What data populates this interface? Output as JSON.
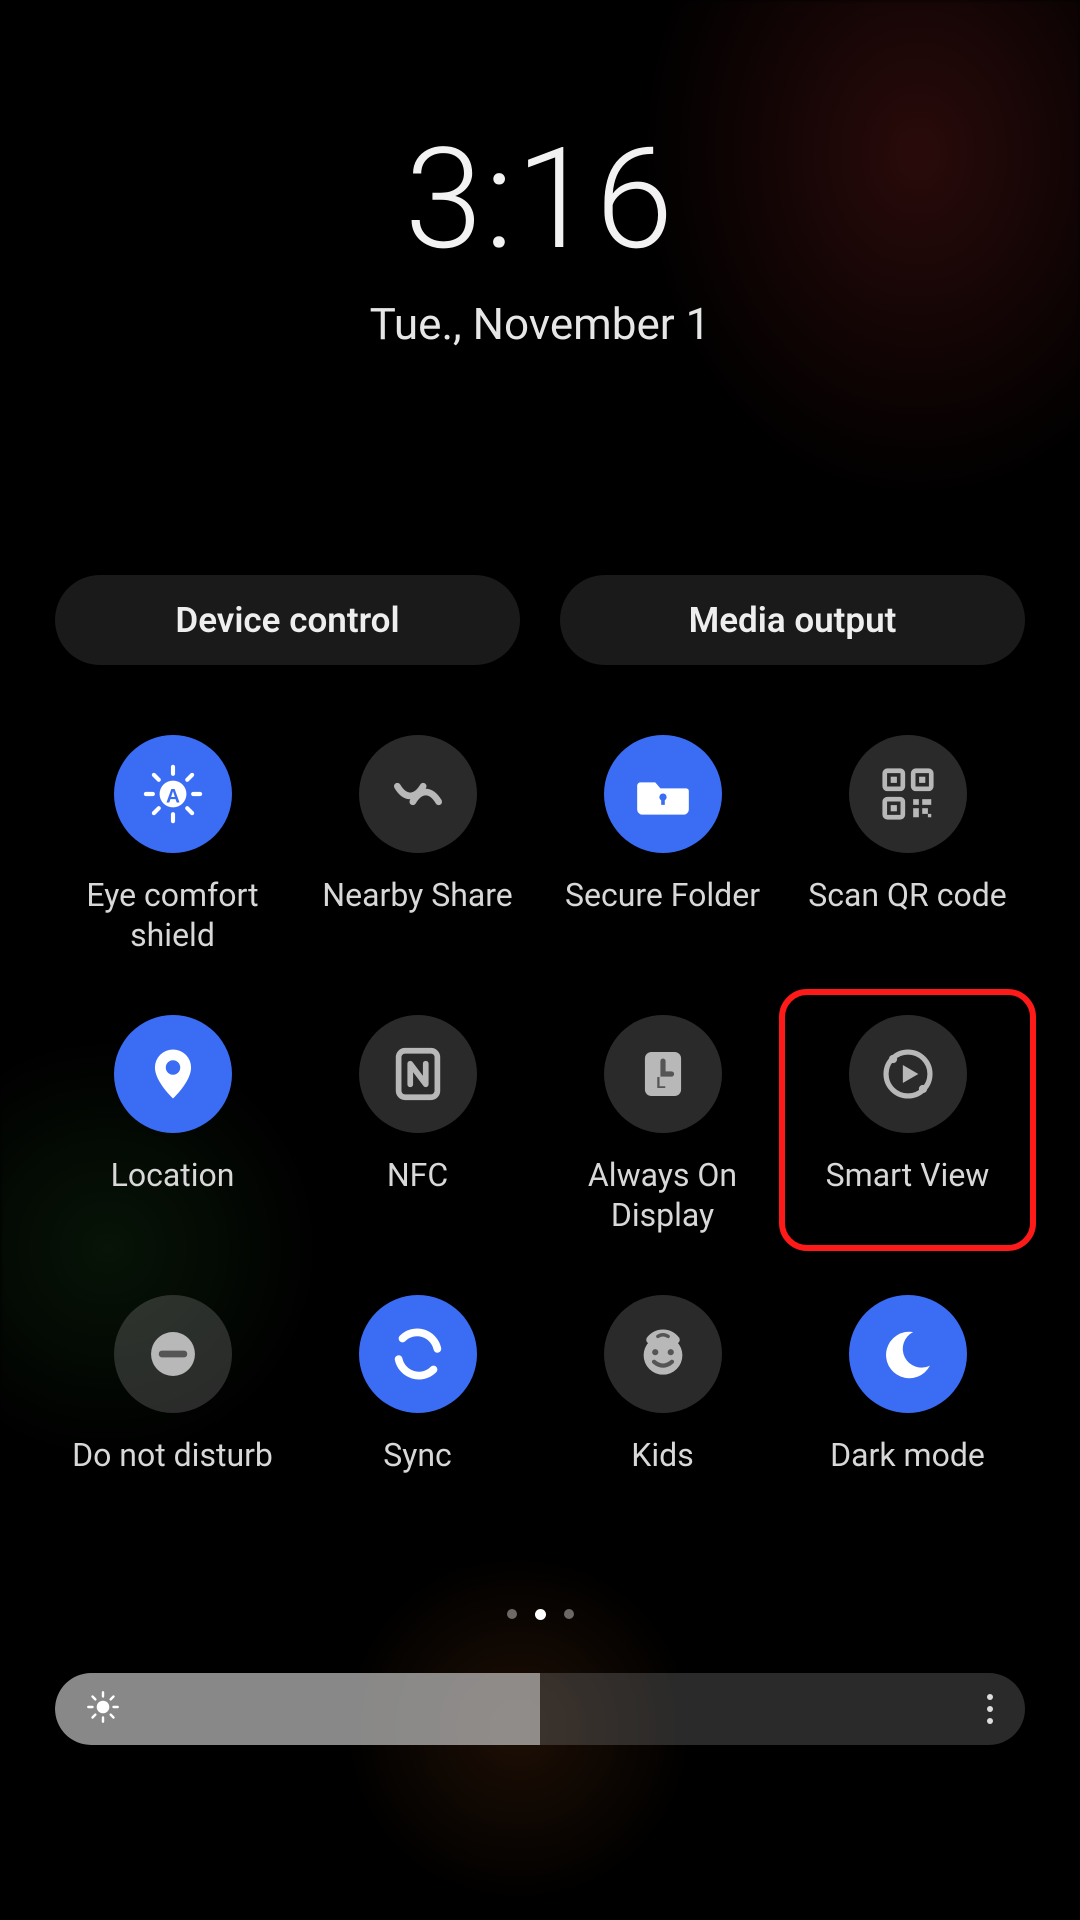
{
  "clock": {
    "time": "3:16",
    "date": "Tue., November 1"
  },
  "pills": {
    "device_control": "Device control",
    "media_output": "Media output"
  },
  "tiles": [
    {
      "id": "eye-comfort-shield",
      "label": "Eye comfort shield",
      "icon": "eye-comfort",
      "active": true
    },
    {
      "id": "nearby-share",
      "label": "Nearby Share",
      "icon": "nearby-share",
      "active": false
    },
    {
      "id": "secure-folder",
      "label": "Secure Folder",
      "icon": "secure-folder",
      "active": true
    },
    {
      "id": "scan-qr-code",
      "label": "Scan QR code",
      "icon": "qr-code",
      "active": false
    },
    {
      "id": "location",
      "label": "Location",
      "icon": "location",
      "active": true
    },
    {
      "id": "nfc",
      "label": "NFC",
      "icon": "nfc",
      "active": false
    },
    {
      "id": "always-on-display",
      "label": "Always On Display",
      "icon": "clock-square",
      "active": false
    },
    {
      "id": "smart-view",
      "label": "Smart View",
      "icon": "smart-view",
      "active": false
    },
    {
      "id": "do-not-disturb",
      "label": "Do not disturb",
      "icon": "dnd",
      "active": false
    },
    {
      "id": "sync",
      "label": "Sync",
      "icon": "sync",
      "active": true
    },
    {
      "id": "kids",
      "label": "Kids",
      "icon": "kids",
      "active": false
    },
    {
      "id": "dark-mode",
      "label": "Dark mode",
      "icon": "moon",
      "active": true
    }
  ],
  "highlight": {
    "tile_id": "smart-view"
  },
  "pagination": {
    "count": 3,
    "active_index": 1
  },
  "brightness": {
    "percent": 50
  },
  "colors": {
    "accent_on": "#3a6cf4",
    "accent_off": "rgba(120,120,120,0.35)",
    "highlight": "#ff1a1a"
  }
}
